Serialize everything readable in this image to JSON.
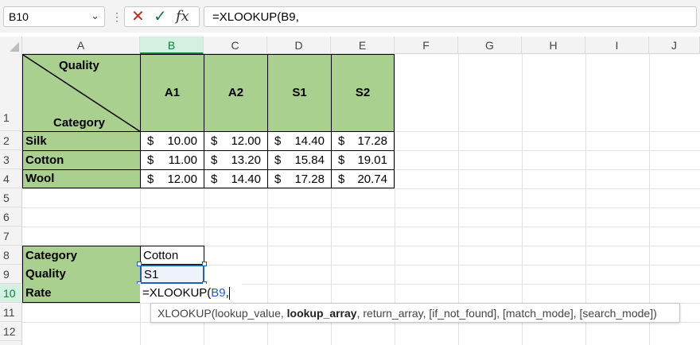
{
  "formula_bar": {
    "name_box": "B10",
    "chevron_icon": "chevron-down-icon",
    "more_icon": "vertical-dots-icon",
    "cancel_icon": "✕",
    "enter_icon": "✓",
    "function_icon": "fx",
    "formula": "=XLOOKUP(B9,"
  },
  "columns": [
    "A",
    "B",
    "C",
    "D",
    "E",
    "F",
    "G",
    "H",
    "I",
    "J"
  ],
  "selected_column": "B",
  "rows": [
    "1",
    "2",
    "3",
    "4",
    "5",
    "6",
    "7",
    "8",
    "9",
    "10",
    "11",
    "12"
  ],
  "selected_row": "10",
  "table": {
    "header_top": "Quality",
    "header_bottom": "Category",
    "qualities": [
      "A1",
      "A2",
      "S1",
      "S2"
    ],
    "currency": "$",
    "data": [
      {
        "category": "Silk",
        "prices": [
          "10.00",
          "12.00",
          "14.40",
          "17.28"
        ]
      },
      {
        "category": "Cotton",
        "prices": [
          "11.00",
          "13.20",
          "15.84",
          "19.01"
        ]
      },
      {
        "category": "Wool",
        "prices": [
          "12.00",
          "14.40",
          "17.28",
          "20.74"
        ]
      }
    ]
  },
  "lookup": {
    "category_label": "Category",
    "category_value": "Cotton",
    "quality_label": "Quality",
    "quality_value": "S1",
    "rate_label": "Rate",
    "rate_formula_prefix": "=XLOOKUP(",
    "rate_formula_ref": "B9",
    "rate_formula_suffix": ","
  },
  "tooltip": {
    "fn": "XLOOKUP(",
    "arg1": "lookup_value, ",
    "arg2_bold": "lookup_array",
    "rest": ", return_array, [if_not_found], [match_mode], [search_mode])"
  },
  "colors": {
    "header_green": "#a9d08e",
    "excel_green": "#107c41",
    "ref_blue": "#1f5fbf"
  }
}
